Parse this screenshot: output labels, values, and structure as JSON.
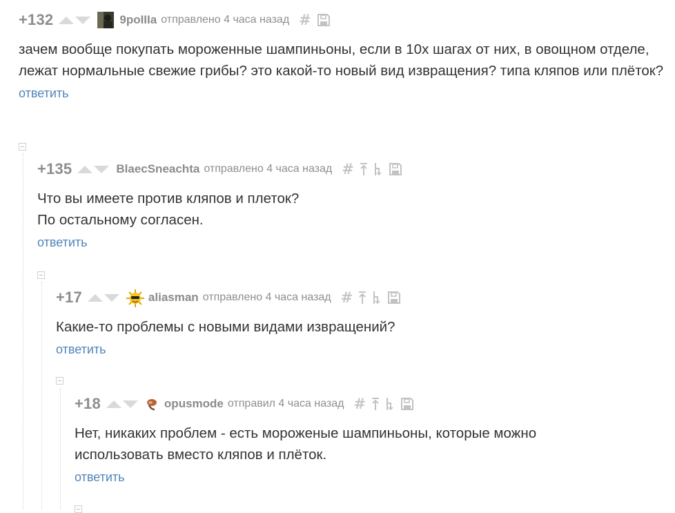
{
  "comments": [
    {
      "rating": "+132",
      "author": "9poIIIa",
      "sent": "отправлено 4 часа назад",
      "text": "зачем вообще покупать мороженные шампиньоны, если в 10х шагах от них, в овощном отделе, лежат нормальные свежие грибы? это какой-то новый вид извращения? типа кляпов или плёток?",
      "reply": "ответить"
    },
    {
      "rating": "+135",
      "author": "BlaecSneachta",
      "sent": "отправлено 4 часа назад",
      "text": "Что вы имеете против кляпов и плеток?\nПо остальному согласен.",
      "reply": "ответить"
    },
    {
      "rating": "+17",
      "author": "aliasman",
      "sent": "отправлено 4 часа назад",
      "text": "Какие-то проблемы с новыми видами извращений?",
      "reply": "ответить"
    },
    {
      "rating": "+18",
      "author": "opusmode",
      "sent": "отправил 4 часа назад",
      "text": "Нет, никаких проблем - есть мороженые шампиньоны, которые можно использовать вместо кляпов и плёток.",
      "reply": "ответить"
    }
  ],
  "icons": {
    "hash": "#",
    "vote_up": "triangle-up-icon",
    "vote_down": "triangle-down-icon",
    "save": "floppy-disk-icon",
    "parent": "arrow-up-icon",
    "branch": "branch-icon",
    "collapse": "minus-box-icon"
  },
  "colors": {
    "link": "#4f84b9",
    "meta": "#8e8e8e",
    "text": "#333333"
  }
}
